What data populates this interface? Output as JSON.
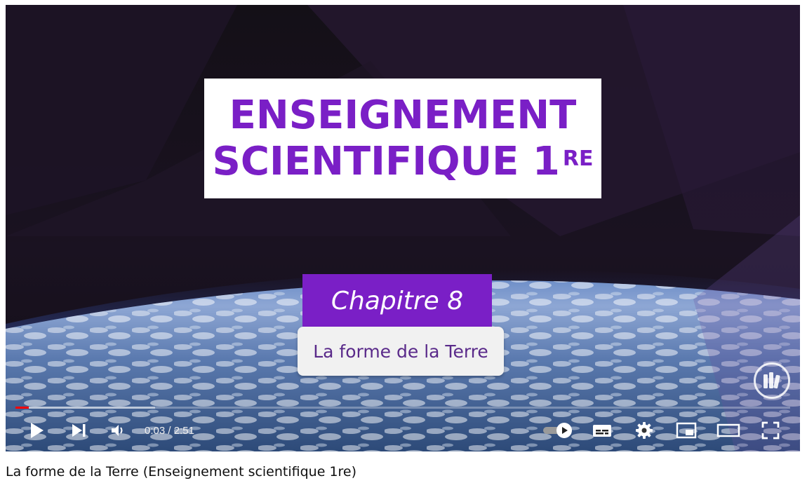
{
  "player": {
    "title_line1": "ENSEIGNEMENT",
    "title_line2": "SCIENTIFIQUE 1",
    "title_sup": "RE",
    "chapter": "Chapitre 8",
    "subtitle": "La forme de la Terre",
    "progress_fraction": 0.0175,
    "buffer_fraction": 0.18,
    "accent_color": "#7a1fc6",
    "progress_color": "#ff0000"
  },
  "controls": {
    "play_icon": "play-icon",
    "next_icon": "next-icon",
    "volume_icon": "volume-icon",
    "current_time": "0:03",
    "separator": " / ",
    "duration": "2:51",
    "autoplay_icon": "autoplay-toggle-icon",
    "subtitles_icon": "subtitles-icon",
    "settings_icon": "settings-gear-icon",
    "miniplayer_icon": "miniplayer-icon",
    "theater_icon": "theater-mode-icon",
    "fullscreen_icon": "fullscreen-icon"
  },
  "video": {
    "title": "La forme de la Terre (Enseignement scientifique 1re)"
  }
}
